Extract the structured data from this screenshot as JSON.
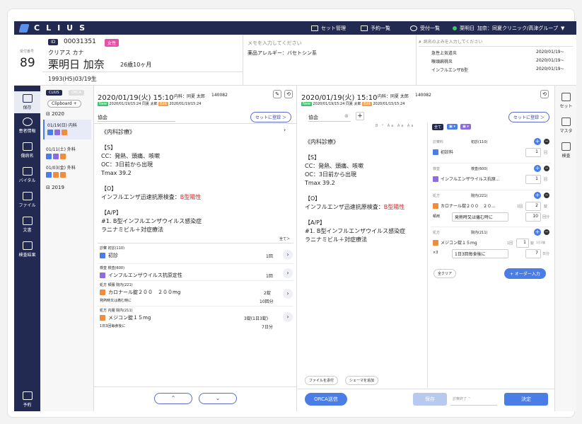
{
  "topbar": {
    "logo": "CLIUS",
    "nav": [
      "セット管理",
      "予約一覧",
      "受付一覧"
    ],
    "doctor": "栗明日",
    "clinic": "加奈：同夏クリニック/高津グループ"
  },
  "patient": {
    "id_label": "ID",
    "id": "00031351",
    "gender": "女性",
    "reception_label": "受付番号",
    "reception_no": "89",
    "kana": "クリアス カナ",
    "name": "栗明日 加奈",
    "age": "26歳10ヶ月",
    "dob": "1993(H5)03/19生"
  },
  "memo": {
    "placeholder": "メモを入力してください",
    "allergy": "薬品アレルギー：バセトシン系"
  },
  "disease": {
    "search_placeholder": "病名のよみを入力してください",
    "items": [
      {
        "name": "急性上気道炎",
        "date": "2020/01/19~"
      },
      {
        "name": "喉頭扁桃炎",
        "date": "2020/01/19~"
      },
      {
        "name": "インフルエンザB型",
        "date": "2020/01/19~"
      }
    ]
  },
  "leftnav": [
    "保存",
    "患者情報",
    "傷病名",
    "バイタル",
    "ファイル",
    "文書",
    "検査結果",
    "予約"
  ],
  "history": {
    "tabs": [
      "CLIUS",
      "ORCA"
    ],
    "clipboard": "Clipboard +",
    "years": [
      "2020",
      "2019"
    ],
    "visits": [
      {
        "date": "01/19(日) 内科"
      },
      {
        "date": "01/11(土) 外科"
      },
      {
        "date": "01/03(金) 外科"
      }
    ]
  },
  "note_left": {
    "datetime": "2020/01/19(火) 15:10",
    "dept": "内科：同夏 太郎",
    "id": "140082",
    "meta1": "2020/01/19/15:24 同夏 太郎",
    "meta2": "2020/01/19/15:24",
    "tab": "協会",
    "set_btn": "セットに登録 ＞",
    "content_head": "《内科診療》",
    "soap": {
      "s_head": "【S】",
      "s1": "CC：発熱、頭痛、咳嗽",
      "s2": "OC：3日前から出現",
      "s3": "Tmax 39.2",
      "o_head": "【O】",
      "o1": "インフルエンザ迅速抗原検査：",
      "o1b": "B型陽性",
      "a_head": "【A/P】",
      "a1": "#1. B型インフルエンザウイルス感染症",
      "a2": "ラニナミビル＋対症療法"
    },
    "all_link": "全て＞",
    "orders": [
      {
        "cat": "診察 初診(110)",
        "name": "初診",
        "qty": "1回",
        "color": "#4a7ee6"
      },
      {
        "cat": "検査 検査(600)",
        "name": "インフルエンザウイルス抗原定性",
        "qty": "1回",
        "color": "#8d6ce0"
      },
      {
        "cat": "処方 頓服 院内(221)",
        "name": "カロナール錠２００　２００mg",
        "sub": "発熱時又は痛む時に",
        "qty": "2錠",
        "qty2": "10回分",
        "color": "#f08c3a"
      },
      {
        "cat": "処方 内服 院内(211)",
        "name": "メジコン錠１５mg",
        "sub": "1日3回毎食後に",
        "qty": "3錠(1日3錠)",
        "qty2": "7日分",
        "color": "#f08c3a"
      }
    ]
  },
  "note_right": {
    "datetime": "2020/01/19(火) 15:10",
    "dept": "内科：同夏 太郎",
    "id": "140082",
    "meta": "2020/01/19/15:24 同夏 太郎",
    "meta2": "2020/01/15/15:24",
    "tab": "協会",
    "set_btn": "セットに登録 ＞",
    "content_head": "《内科診療》",
    "file_btn": "ファイルを添付",
    "schema_btn": "シェーマを追加",
    "orca_btn": "ORCA送信",
    "orders": [
      {
        "cat": "診察料",
        "code": "初診(110)",
        "name": "初診料",
        "qty": "1",
        "unit": "回"
      },
      {
        "cat": "検査",
        "code": "検査(600)",
        "name": "インフルエンザウイルス抗原...",
        "qty": "1",
        "unit": "回"
      },
      {
        "cat": "処方",
        "code": "院内(221)",
        "name": "カロナール錠２００　２０...",
        "qty": "2",
        "unit": "錠",
        "extra": "1回",
        "method": "頓用",
        "usage": "発熱時又は痛む時に",
        "days": "10",
        "days_unit": "回分"
      },
      {
        "cat": "処方",
        "code": "院内(211)",
        "name": "メジコン錠１５mg",
        "qty": "1",
        "unit": "錠",
        "extra": "1回",
        "extra2": "1日3錠",
        "method": "×3",
        "usage": "1日3回毎食後に",
        "days": "7",
        "days_unit": "日分"
      }
    ],
    "clear_btn": "全クリア",
    "order_btn": "+ オーダー入力",
    "save_btn": "保存",
    "sign_btn": "診察終了",
    "confirm_btn": "決定",
    "toolbar": [
      "全て"
    ]
  },
  "rightnav": [
    "セット",
    "マスタ",
    "検査"
  ],
  "colors": {
    "navy": "#232a52",
    "accent": "#4a7ee6",
    "green": "#3ec46d",
    "red": "#d42424"
  }
}
